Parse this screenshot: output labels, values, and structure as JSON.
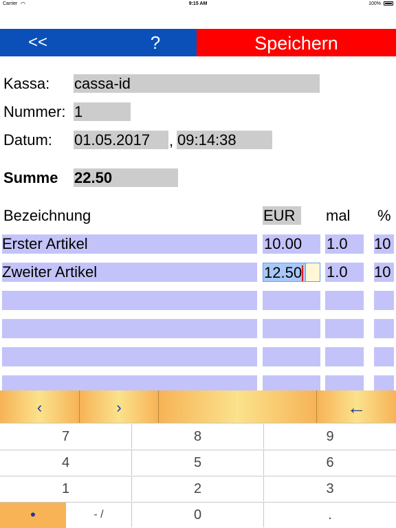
{
  "status": {
    "carrier": "Carrier",
    "time": "9:15 AM",
    "battery": "100%"
  },
  "toolbar": {
    "back": "<<",
    "help": "?",
    "save": "Speichern"
  },
  "form": {
    "kassa_label": "Kassa:",
    "kassa_value": "cassa-id",
    "nummer_label": "Nummer:",
    "nummer_value": "1",
    "datum_label": "Datum:",
    "date_value": "01.05.2017",
    "comma": ",",
    "time_value": "09:14:38",
    "summe_label": "Summe",
    "summe_value": "22.50"
  },
  "table": {
    "headers": {
      "name": "Bezeichnung",
      "price": "EUR",
      "qty": "mal",
      "pct": "%"
    },
    "rows": [
      {
        "name": "Erster Artikel",
        "price": "10.00",
        "qty": "1.0",
        "pct": "10"
      },
      {
        "name": "Zweiter Artikel",
        "price": "12.50",
        "qty": "1.0",
        "pct": "10"
      },
      {
        "name": "",
        "price": "",
        "qty": "",
        "pct": ""
      },
      {
        "name": "",
        "price": "",
        "qty": "",
        "pct": ""
      },
      {
        "name": "",
        "price": "",
        "qty": "",
        "pct": ""
      },
      {
        "name": "",
        "price": "",
        "qty": "",
        "pct": ""
      }
    ]
  },
  "keyboard": {
    "prev": "‹",
    "next": "›",
    "backspace": "←",
    "keys": [
      "7",
      "8",
      "9",
      "4",
      "5",
      "6",
      "1",
      "2",
      "3",
      "•",
      "- /",
      "0",
      "."
    ]
  },
  "colors": {
    "nav_blue": "#0b50b8",
    "save_red": "#ff0000",
    "row_fill": "#c3c3fa",
    "field_gray": "#cccccc",
    "toolbar_orange": "#f7b356"
  }
}
